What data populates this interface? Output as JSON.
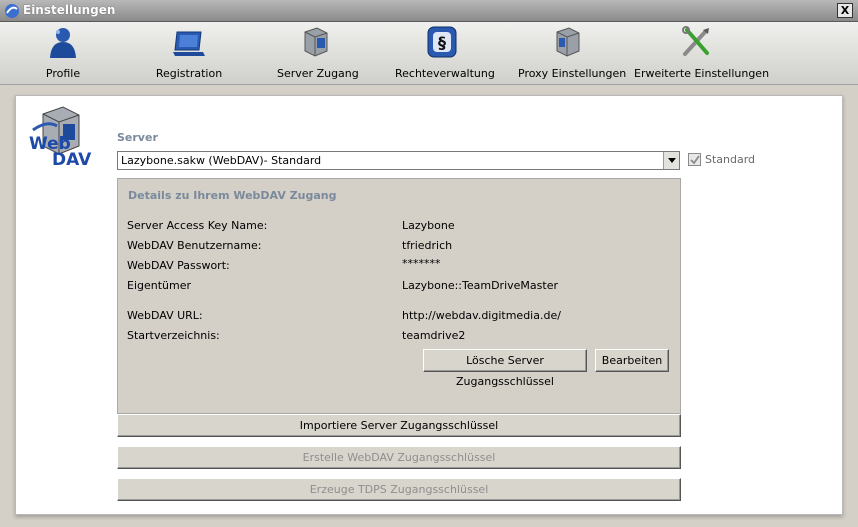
{
  "window": {
    "title": "Einstellungen",
    "close_label": "X"
  },
  "toolbar": {
    "items": [
      {
        "label": "Profile",
        "icon": "profile-icon"
      },
      {
        "label": "Registration",
        "icon": "registration-icon"
      },
      {
        "label": "Server Zugang",
        "icon": "server-access-icon"
      },
      {
        "label": "Rechteverwaltung",
        "icon": "rights-management-icon"
      },
      {
        "label": "Proxy Einstellungen",
        "icon": "proxy-icon"
      },
      {
        "label": "Erweiterte Einstellungen",
        "icon": "advanced-settings-icon"
      }
    ]
  },
  "logo": {
    "line1": "Web",
    "line2": "DAV"
  },
  "server": {
    "label": "Server",
    "selected": "Lazybone.sakw (WebDAV)- Standard",
    "standard_label": "Standard",
    "standard_checked": true
  },
  "details": {
    "title": "Details zu Ihrem WebDAV Zugang",
    "rows": [
      {
        "label": "Server Access Key Name:",
        "value": "Lazybone"
      },
      {
        "label": "WebDAV Benutzername:",
        "value": "tfriedrich"
      },
      {
        "label": "WebDAV Passwort:",
        "value": "*******"
      },
      {
        "label": "Eigentümer",
        "value": "Lazybone::TeamDriveMaster"
      },
      {
        "label": "WebDAV URL:",
        "value": "http://webdav.digitmedia.de/"
      },
      {
        "label": "Startverzeichnis:",
        "value": "teamdrive2"
      }
    ],
    "delete_button": "Lösche Server Zugangsschlüssel",
    "edit_button": "Bearbeiten"
  },
  "actions": {
    "import": "Importiere Server Zugangsschlüssel",
    "create": "Erstelle WebDAV Zugangsschlüssel",
    "generate": "Erzeuge TDPS Zugangsschlüssel"
  },
  "colors": {
    "section_heading": "#7a8a9c",
    "panel_bg": "#d4d0c8",
    "disabled_text": "#8e8e8e"
  }
}
